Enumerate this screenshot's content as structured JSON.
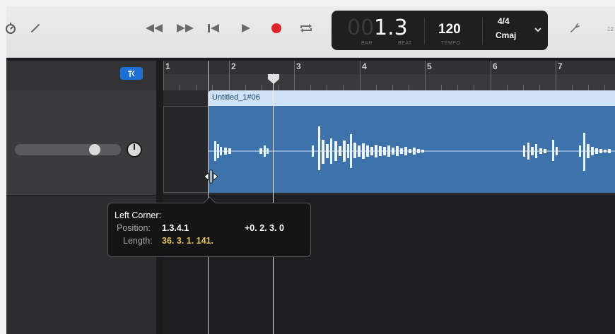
{
  "transport": {
    "buttons": [
      "rewind",
      "fast-forward",
      "go-to-beginning",
      "play",
      "record",
      "cycle"
    ]
  },
  "lcd": {
    "bar_dim": "00",
    "position": "1.3",
    "bar_label": "BAR",
    "beat_label": "BEAT",
    "tempo": "120",
    "tempo_label": "TEMPO",
    "time_signature": "4/4",
    "key": "Cmaj"
  },
  "right_edge_text": "12",
  "ruler": {
    "bars": [
      "1",
      "2",
      "3",
      "4",
      "5",
      "6",
      "7"
    ]
  },
  "track": {
    "smart_controls_icon": "smart-controls-icon"
  },
  "region": {
    "name": "Untitled_1#06",
    "color": "#3e72aa",
    "header_color": "#cfe2f6"
  },
  "tooltip": {
    "title": "Left Corner:",
    "position_label": "Position:",
    "position_value": "1.3.4.1",
    "delta": "+0. 2. 3. 0",
    "length_label": "Length:",
    "length_value": "36. 3. 1. 141."
  },
  "colors": {
    "accent_blue": "#1e6fd4",
    "record_red": "#e0232b",
    "length_value": "#e8c35a"
  }
}
